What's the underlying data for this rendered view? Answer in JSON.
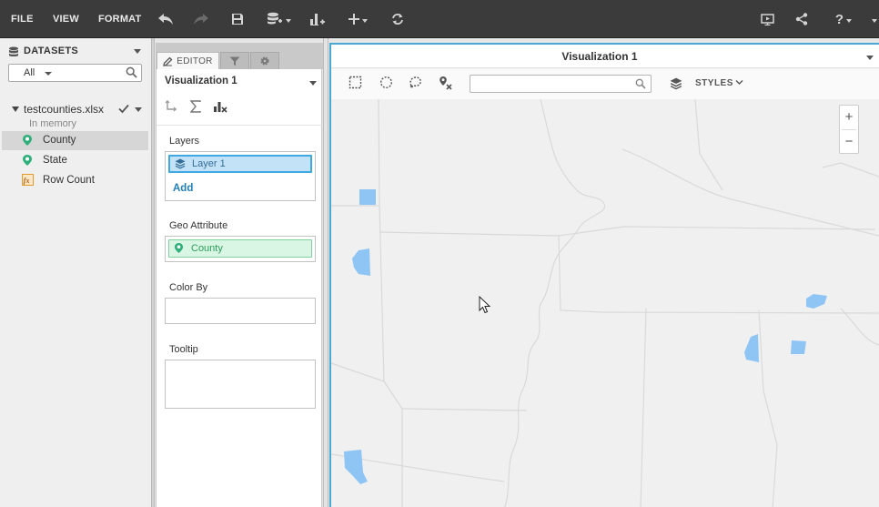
{
  "menu": {
    "file": "FILE",
    "view": "VIEW",
    "format": "FORMAT"
  },
  "toolbar_icons": [
    "undo-icon",
    "redo-icon",
    "save-icon",
    "add-data-icon",
    "add-visualization-icon",
    "add-icon",
    "refresh-icon",
    "present-icon",
    "share-icon",
    "help-icon"
  ],
  "toolbar_help_label": "?",
  "datasets": {
    "title": "DATASETS",
    "filter_value": "All",
    "file_name": "testcounties.xlsx",
    "file_status": "In memory",
    "items": [
      {
        "label": "County",
        "icon": "geo-pin-icon",
        "selected": true
      },
      {
        "label": "State",
        "icon": "geo-pin-icon",
        "selected": false
      },
      {
        "label": "Row Count",
        "icon": "formula-icon",
        "selected": false
      }
    ]
  },
  "editor": {
    "tabs": {
      "editor": "EDITOR"
    },
    "viz_name": "Visualization 1",
    "layers_label": "Layers",
    "layer_name": "Layer 1",
    "add_label": "Add",
    "geo_label": "Geo Attribute",
    "geo_value": "County",
    "color_by_label": "Color By",
    "tooltip_label": "Tooltip"
  },
  "viz": {
    "title": "Visualization 1",
    "styles_label": "STYLES",
    "zoom_in": "+",
    "zoom_out": "−",
    "search_value": ""
  },
  "colors": {
    "topbar": "#3b3b3b",
    "accent": "#4aa9d2",
    "county_fill": "#8ec5f5",
    "layer_pill": "#c3e2f7",
    "geo_pill": "#d9f5e3",
    "geo_green": "#2fb07a"
  }
}
